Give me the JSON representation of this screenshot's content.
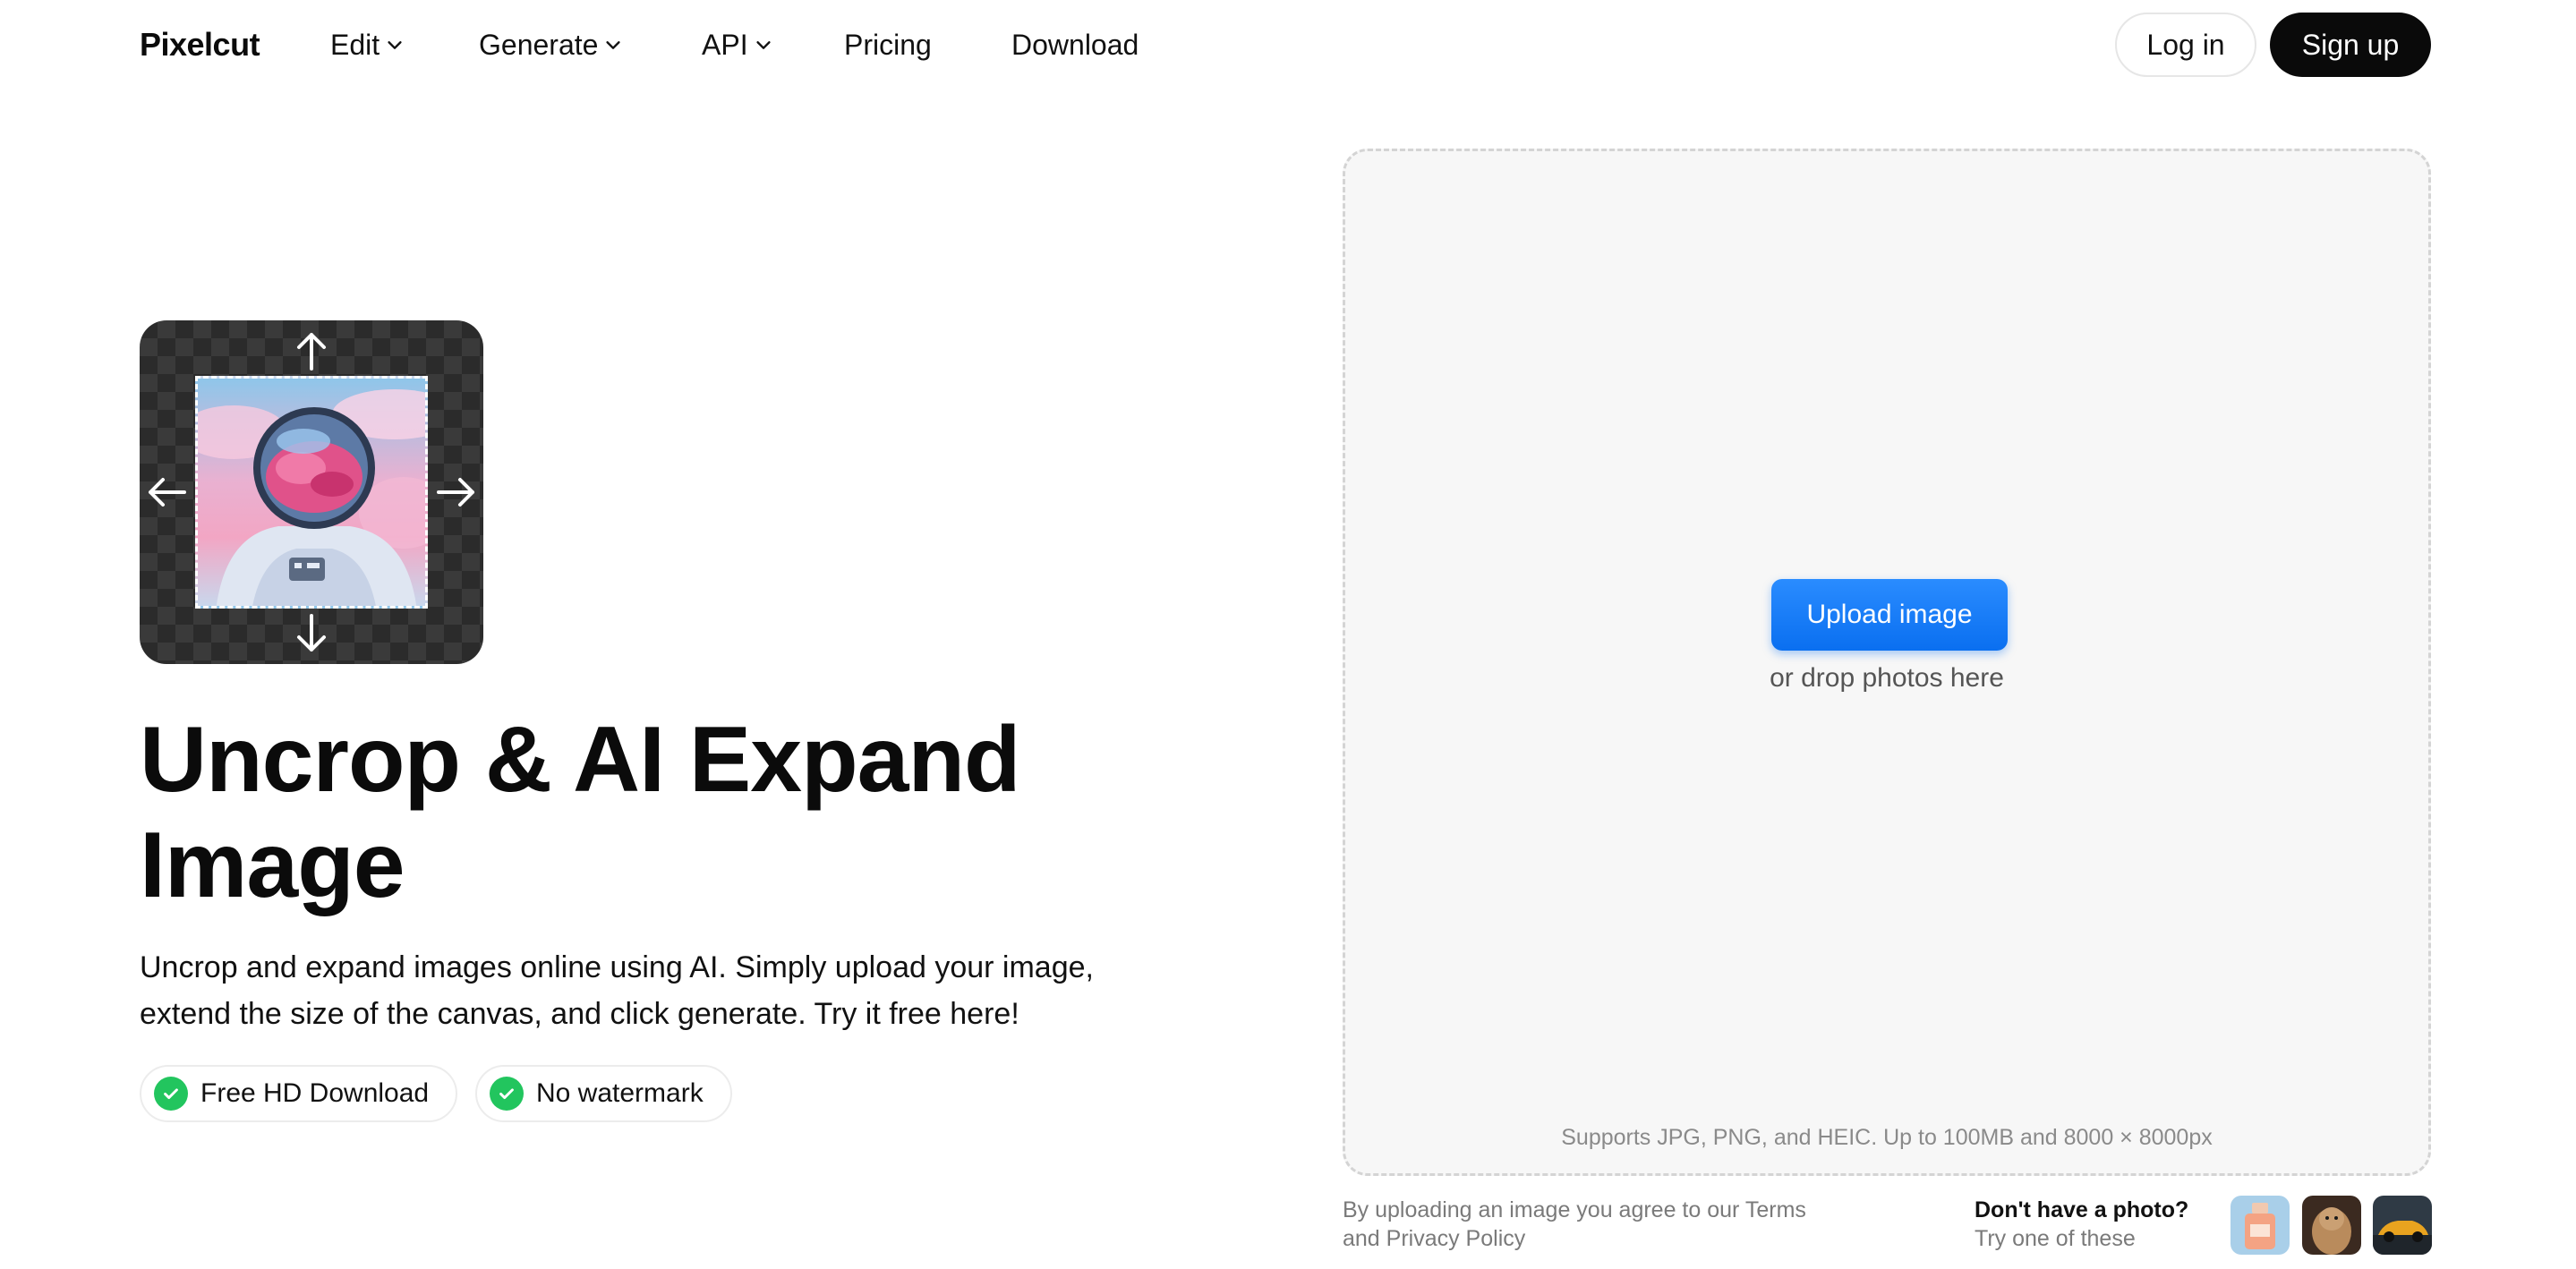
{
  "nav": {
    "logo": "Pixelcut",
    "links": [
      {
        "label": "Edit",
        "dropdown": true
      },
      {
        "label": "Generate",
        "dropdown": true
      },
      {
        "label": "API",
        "dropdown": true
      },
      {
        "label": "Pricing",
        "dropdown": false
      },
      {
        "label": "Download",
        "dropdown": false
      }
    ],
    "login": "Log in",
    "signup": "Sign up"
  },
  "hero": {
    "title": "Uncrop & AI Expand Image",
    "description": "Uncrop and expand images online using AI. Simply upload your image, extend the size of the canvas, and click generate. Try it free here!",
    "badges": [
      "Free HD Download",
      "No watermark"
    ]
  },
  "upload": {
    "button": "Upload image",
    "hint": "or drop photos here",
    "supports": "Supports JPG, PNG, and HEIC. Up to 100MB and 8000 × 8000px",
    "legal": "By uploading an image you agree to our Terms and Privacy Policy",
    "try_title": "Don't have a photo?",
    "try_sub": "Try one of these"
  },
  "colors": {
    "accent": "#0a6ff0",
    "check": "#22c55e",
    "dark": "#0a0a0a"
  }
}
